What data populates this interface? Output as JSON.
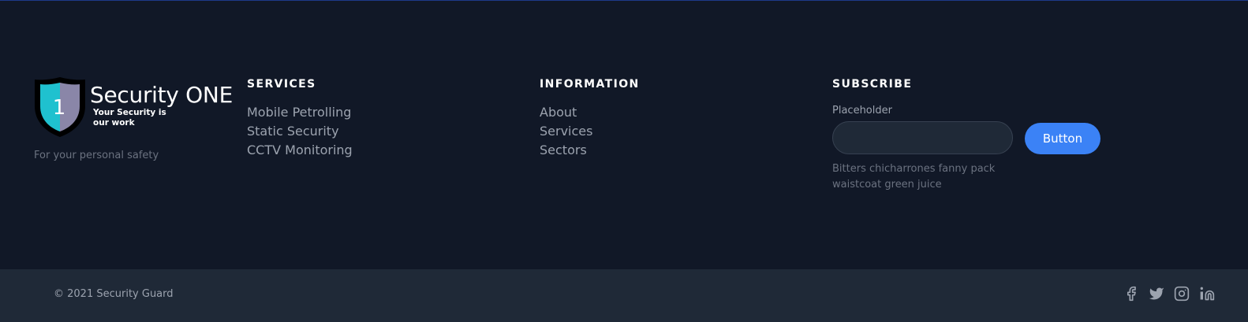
{
  "brand": {
    "logo_number": "1",
    "logo_title": "Security ONE",
    "logo_tagline": "Your Security is our work",
    "description": "For your personal safety",
    "shield_colors": {
      "left": "#1fc1cf",
      "right": "#8a86a8",
      "border": "#000000"
    }
  },
  "services": {
    "heading": "SERVICES",
    "links": [
      "Mobile Petrolling",
      "Static Security",
      "CCTV Monitoring"
    ]
  },
  "information": {
    "heading": "INFORMATION",
    "links": [
      "About",
      "Services",
      "Sectors"
    ]
  },
  "subscribe": {
    "heading": "SUBSCRIBE",
    "field_label": "Placeholder",
    "input_value": "",
    "button_label": "Button",
    "description": "Bitters chicharrones fanny pack waistcoat green juice"
  },
  "bottom": {
    "copyright": "© 2021 Security Guard",
    "social_icons": [
      "facebook-icon",
      "twitter-icon",
      "instagram-icon",
      "linkedin-icon"
    ]
  },
  "colors": {
    "background": "#111827",
    "bottom_bar": "#1f2937",
    "accent": "#3b82f6",
    "top_border": "#1e3a8a"
  }
}
